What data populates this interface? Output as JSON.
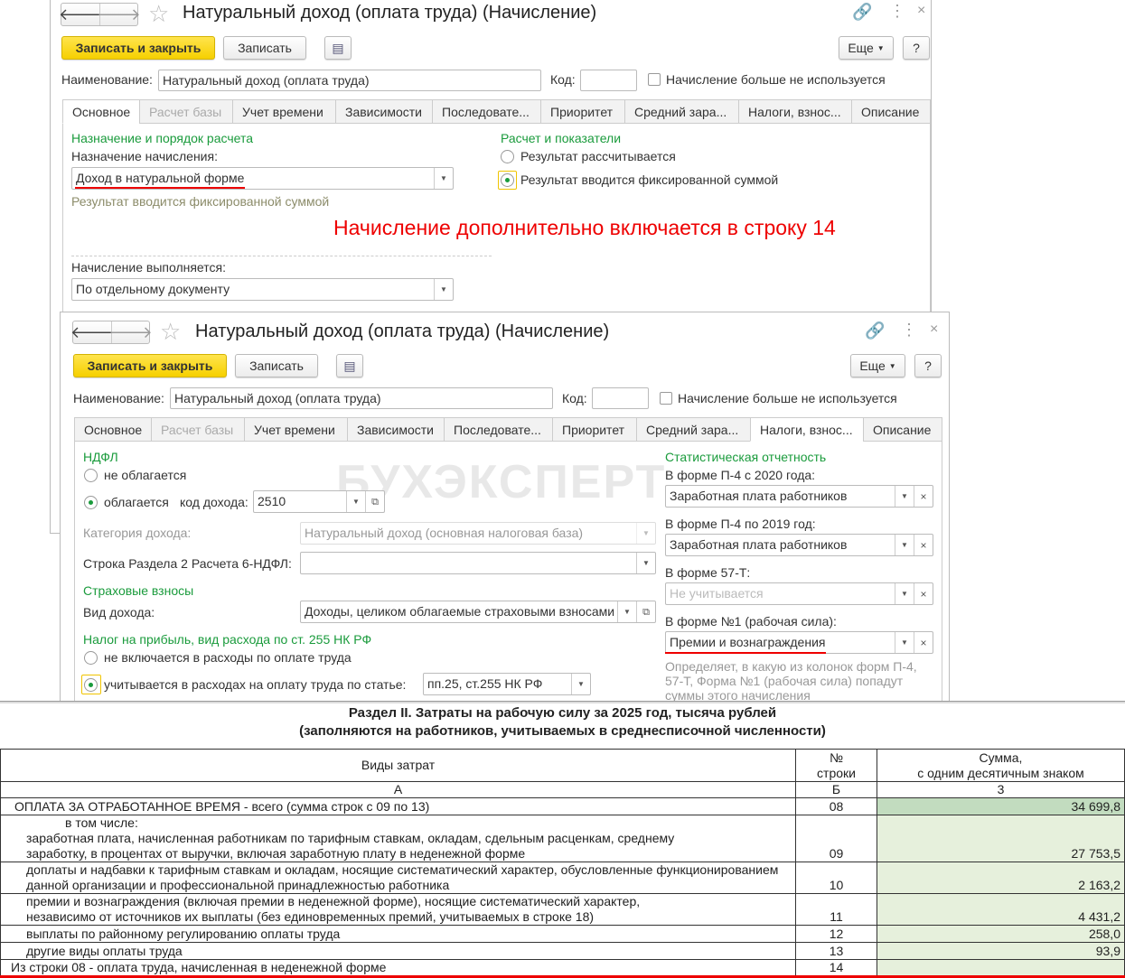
{
  "window1": {
    "title": "Натуральный доход (оплата труда) (Начисление)",
    "save_close": "Записать и закрыть",
    "save": "Записать",
    "more": "Еще",
    "help": "?",
    "name_label": "Наименование:",
    "name_value": "Натуральный доход (оплата труда)",
    "code_label": "Код:",
    "code_value": "",
    "unused_label": "Начисление больше не используется",
    "tabs": [
      "Основное",
      "Расчет базы",
      "Учет времени",
      "Зависимости",
      "Последовате...",
      "Приоритет",
      "Средний зара...",
      "Налоги, взнос...",
      "Описание"
    ],
    "active_tab": "Основное",
    "section_purpose": "Назначение и порядок расчета",
    "purpose_label": "Назначение начисления:",
    "purpose_value": "Доход в натуральной форме",
    "purpose_hint": "Результат вводится фиксированной суммой",
    "section_calc": "Расчет и показатели",
    "radio_calc": "Результат рассчитывается",
    "radio_fixed": "Результат вводится фиксированной суммой",
    "annotation": "Начисление дополнительно включается в строку 14",
    "exec_label": "Начисление выполняется:",
    "exec_value": "По отдельному документу"
  },
  "window2": {
    "title": "Натуральный доход (оплата труда) (Начисление)",
    "save_close": "Записать и закрыть",
    "save": "Записать",
    "more": "Еще",
    "help": "?",
    "name_label": "Наименование:",
    "name_value": "Натуральный доход (оплата труда)",
    "code_label": "Код:",
    "code_value": "",
    "unused_label": "Начисление больше не используется",
    "tabs": [
      "Основное",
      "Расчет базы",
      "Учет времени",
      "Зависимости",
      "Последовате...",
      "Приоритет",
      "Средний зара...",
      "Налоги, взнос...",
      "Описание"
    ],
    "active_tab": "Налоги, взнос...",
    "ndfl": "НДФЛ",
    "not_taxed": "не облагается",
    "taxed": "облагается",
    "income_code_label": "код дохода:",
    "income_code": "2510",
    "category_label": "Категория дохода:",
    "category_value": "Натуральный доход (основная налоговая база)",
    "line6_label": "Строка Раздела 2 Расчета 6-НДФЛ:",
    "line6_value": "",
    "insurance": "Страховые взносы",
    "income_type_label": "Вид дохода:",
    "income_type_value": "Доходы, целиком облагаемые страховыми взносами",
    "profit_tax": "Налог на прибыль, вид расхода по ст. 255 НК РФ",
    "not_included": "не включается в расходы по оплате труда",
    "included": "учитывается в расходах на оплату труда по статье:",
    "article_value": "пп.25, ст.255 НК РФ",
    "stat": "Статистическая отчетность",
    "p4_2020_label": "В форме П-4 с 2020 года:",
    "p4_2020_value": "Заработная плата работников",
    "p4_2019_label": "В форме П-4 по 2019 год:",
    "p4_2019_value": "Заработная плата работников",
    "f57_label": "В форме 57-Т:",
    "f57_placeholder": "Не учитывается",
    "f1_label": "В форме №1 (рабочая сила):",
    "f1_value": "Премии и вознаграждения",
    "hint1": "Определяет, в какую из колонок форм П-4,",
    "hint2": "57-Т, Форма №1 (рабочая сила) попадут",
    "hint3": "суммы этого начисления",
    "watermark": "БУХЭКСПЕРТ"
  },
  "report": {
    "title1": "Раздел II. Затраты на рабочую силу за 2025 год, тысяча рублей",
    "title2": "(заполняются на работников, учитываемых в среднесписочной численности)",
    "headers": [
      "Виды затрат",
      "№ строки",
      "Сумма, с одним десятичным знаком"
    ],
    "header_line2": [
      "строки",
      "с одним десятичным знаком"
    ],
    "header_line1": [
      "№",
      "Сумма,"
    ],
    "col_codes": [
      "А",
      "Б",
      "3"
    ],
    "rows": [
      {
        "text": "ОПЛАТА ЗА ОТРАБОТАННОЕ ВРЕМЯ - всего (сумма строк с 09 по 13)",
        "line": "08",
        "value": "34 699,8"
      },
      {
        "pre": "в том числе:",
        "text": "заработная плата, начисленная работникам по тарифным ставкам, окладам, сдельным расценкам, среднему",
        "text2": "заработку, в процентах от выручки, включая заработную плату в неденежной форме",
        "line": "09",
        "value": "27 753,5"
      },
      {
        "text": "доплаты и надбавки к тарифным ставкам и окладам, носящие систематический характер, обусловленные функционированием",
        "text2": "данной организации и профессиональной принадлежностью работника",
        "line": "10",
        "value": "2 163,2"
      },
      {
        "text": "премии и вознаграждения (включая премии в неденежной форме), носящие систематический характер,",
        "text2": "независимо от источников их выплаты (без единовременных премий, учитываемых в строке 18)",
        "line": "11",
        "value": "4 431,2"
      },
      {
        "text": "выплаты по районному регулированию оплаты труда",
        "line": "12",
        "value": "258,0"
      },
      {
        "text": "другие виды оплаты труда",
        "line": "13",
        "value": "93,9"
      },
      {
        "text": "Из строки 08 - оплата труда, начисленная в неденежной форме",
        "line": "14",
        "value": ""
      }
    ]
  },
  "colors": {
    "green": "#1a9b3c",
    "accent": "#f6d000",
    "red": "#e00000",
    "cell": "#e6f0dc"
  }
}
